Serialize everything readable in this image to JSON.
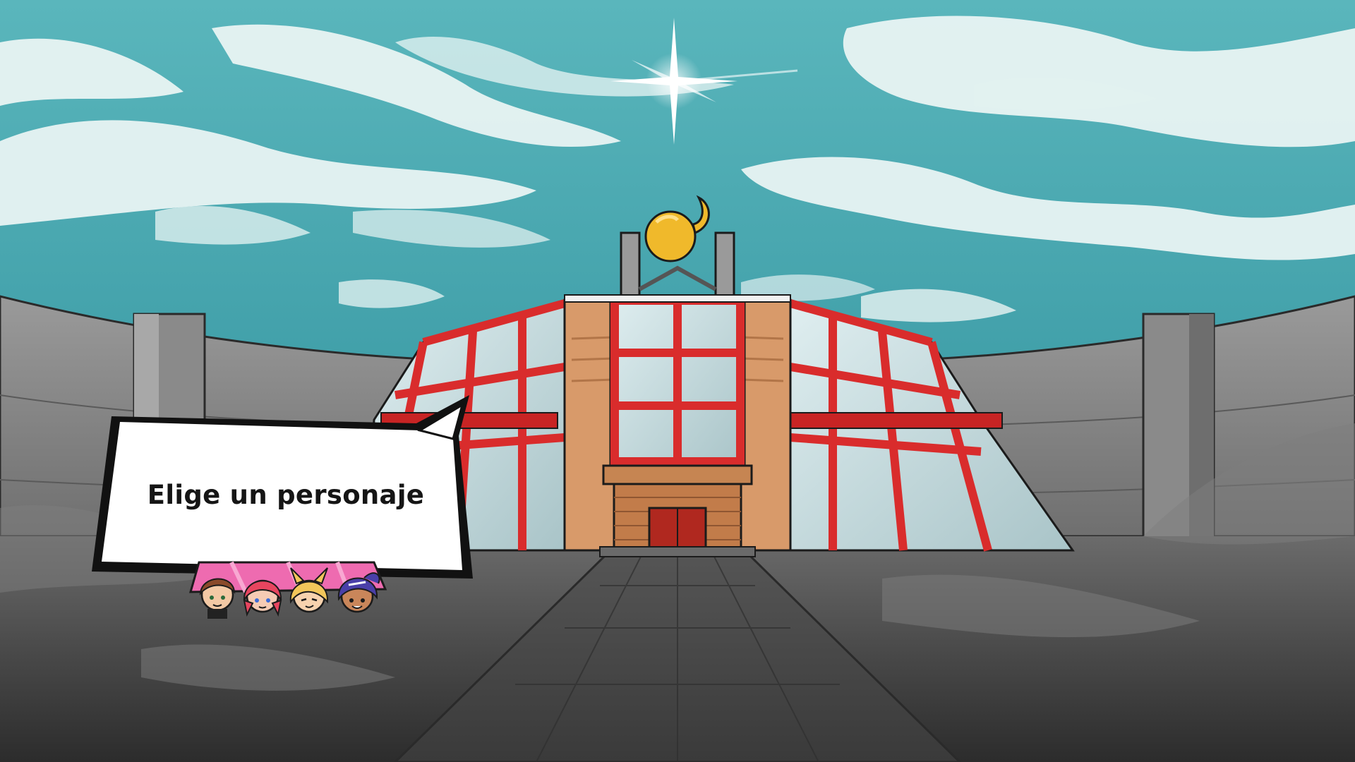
{
  "dialog": {
    "text": "Elige un personaje"
  },
  "characters": [
    {
      "id": "character-1",
      "hair": "#8a4a2a",
      "skin": "#f3c9a5"
    },
    {
      "id": "character-2",
      "hair": "#e8455f",
      "skin": "#f6cbb4"
    },
    {
      "id": "character-3",
      "hair": "#f2c65a",
      "skin": "#f7d2ae"
    },
    {
      "id": "character-4",
      "hair": "#4a3fa8",
      "skin": "#c9865a"
    }
  ],
  "colors": {
    "sky": "#4fb2b9",
    "sky_light": "#86cfcf",
    "building_red": "#d92c2c",
    "glass": "#c9dde0",
    "ground": "#4a4a4a",
    "wall": "#8f8f8f",
    "trophy": "#f0b92b",
    "banner_pink": "#ee6bb0"
  }
}
